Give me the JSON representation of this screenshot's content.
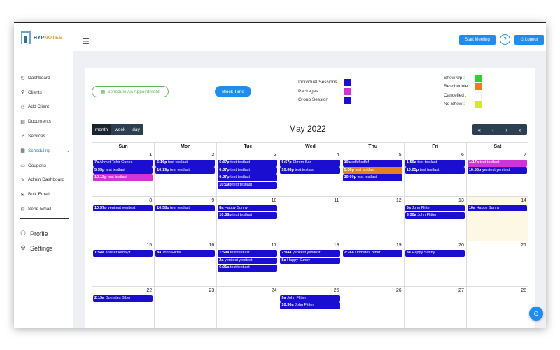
{
  "app": {
    "logo_hyp": "HYP",
    "logo_notes": "NOTES",
    "menu_icon": "hamburger-icon"
  },
  "header": {
    "start_meeting": "Start Meeting",
    "help": "?",
    "logout": "Logout"
  },
  "sidebar": {
    "items": [
      {
        "label": "Dashboard",
        "icon": "◷",
        "name": "dashboard"
      },
      {
        "label": "Clients",
        "icon": "⚲",
        "name": "clients"
      },
      {
        "label": "Add Client",
        "icon": "⚇",
        "name": "add-client"
      },
      {
        "label": "Documents",
        "icon": "▤",
        "name": "documents"
      },
      {
        "label": "Services",
        "icon": "⑂",
        "name": "services"
      },
      {
        "label": "Scheduling",
        "icon": "▦",
        "name": "scheduling",
        "active": true
      },
      {
        "label": "Coupons",
        "icon": "▭",
        "name": "coupons"
      },
      {
        "label": "Admin Dashboard",
        "icon": "✎",
        "name": "admin-dashboard"
      },
      {
        "label": "Bulk Email",
        "icon": "✉",
        "name": "bulk-email"
      },
      {
        "label": "Send Email",
        "icon": "✉",
        "name": "send-email"
      }
    ],
    "bottom": [
      {
        "label": "Profile",
        "icon": "⚇",
        "name": "profile"
      },
      {
        "label": "Settings",
        "icon": "⚙",
        "name": "settings"
      }
    ]
  },
  "toolbar": {
    "schedule": "Schedule An Appointment",
    "block": "Block Time"
  },
  "legend": {
    "types": [
      {
        "label": "Individual Sessions :",
        "color": "#1a0fd1"
      },
      {
        "label": "Packages :",
        "color": "#d233d6"
      },
      {
        "label": "Group Session :",
        "color": "#1a0fd1"
      }
    ],
    "status": [
      {
        "label": "Show Up :",
        "color": "#2fd12f"
      },
      {
        "label": "Reschedule :",
        "color": "#e8801f"
      },
      {
        "label": "Cancelled :",
        "color": "#ffffff"
      },
      {
        "label": "No Show :",
        "color": "#d8e635"
      }
    ]
  },
  "calendar": {
    "views": [
      "month",
      "week",
      "day"
    ],
    "active_view": "month",
    "title": "May 2022",
    "nav": [
      "«",
      "‹",
      "›",
      "»"
    ],
    "weekdays": [
      "Sun",
      "Mon",
      "Tue",
      "Wed",
      "Thu",
      "Fri",
      "Sat"
    ],
    "weeks": [
      [
        {
          "day": "1",
          "events": [
            {
              "time": "7a",
              "title": "Ahmet Tahir Gunes",
              "color": "#1a0fd1"
            },
            {
              "time": "5:55p",
              "title": "test testlast",
              "color": "#1a0fd1"
            },
            {
              "time": "10:19p",
              "title": "test testlast",
              "color": "#d233d6"
            }
          ]
        },
        {
          "day": "2",
          "events": [
            {
              "time": "6:16p",
              "title": "test testlast",
              "color": "#1a0fd1"
            },
            {
              "time": "10:19p",
              "title": "test testlast",
              "color": "#1a0fd1"
            }
          ]
        },
        {
          "day": "3",
          "events": [
            {
              "time": "6:37p",
              "title": "test testlast",
              "color": "#1a0fd1"
            },
            {
              "time": "6:37p",
              "title": "test testlast",
              "color": "#1a0fd1"
            },
            {
              "time": "6:37p",
              "title": "test testlast",
              "color": "#1a0fd1"
            },
            {
              "time": "10:19p",
              "title": "test testlast",
              "color": "#1a0fd1"
            }
          ]
        },
        {
          "day": "4",
          "events": [
            {
              "time": "6:57p",
              "title": "Ekrem Sar",
              "color": "#1a0fd1"
            },
            {
              "time": "10:08p",
              "title": "test testlast",
              "color": "#1a0fd1"
            }
          ]
        },
        {
          "day": "5",
          "events": [
            {
              "time": "10a",
              "title": "sdfsf sdfsf",
              "color": "#1a0fd1"
            },
            {
              "time": "5:56p",
              "title": "test testlast",
              "color": "#e8801f"
            },
            {
              "time": "10:09p",
              "title": "test testlast",
              "color": "#1a0fd1"
            }
          ]
        },
        {
          "day": "6",
          "events": [
            {
              "time": "1:59a",
              "title": "test testlast",
              "color": "#1a0fd1"
            },
            {
              "time": "10:05p",
              "title": "test testlast",
              "color": "#1a0fd1"
            }
          ]
        },
        {
          "day": "7",
          "events": [
            {
              "time": "1:17a",
              "title": "test testlast",
              "color": "#d233d6"
            },
            {
              "time": "10:55p",
              "title": "yenitest yenitest",
              "color": "#1a0fd1"
            }
          ]
        }
      ],
      [
        {
          "day": "8",
          "events": [
            {
              "time": "10:57p",
              "title": "yenitest yenitest",
              "color": "#1a0fd1"
            }
          ]
        },
        {
          "day": "9",
          "events": [
            {
              "time": "10:58p",
              "title": "test testlast",
              "color": "#1a0fd1"
            }
          ]
        },
        {
          "day": "10",
          "events": [
            {
              "time": "8a",
              "title": "Happy Sunny",
              "color": "#1a0fd1"
            },
            {
              "time": "10:58p",
              "title": "test testlast",
              "color": "#1a0fd1"
            }
          ]
        },
        {
          "day": "11",
          "events": []
        },
        {
          "day": "12",
          "events": []
        },
        {
          "day": "13",
          "events": [
            {
              "time": "6a",
              "title": "John Flitter",
              "color": "#1a0fd1"
            },
            {
              "time": "6:30a",
              "title": "John Flitter",
              "color": "#1a0fd1"
            }
          ]
        },
        {
          "day": "14",
          "today": true,
          "events": [
            {
              "time": "10a",
              "title": "Happy Sunny",
              "color": "#1a0fd1"
            }
          ]
        }
      ],
      [
        {
          "day": "15",
          "events": [
            {
              "time": "1:54a",
              "title": "abuzer kadayif",
              "color": "#1a0fd1"
            }
          ]
        },
        {
          "day": "16",
          "events": [
            {
              "time": "8a",
              "title": "John Flitter",
              "color": "#1a0fd1"
            }
          ]
        },
        {
          "day": "17",
          "events": [
            {
              "time": "1:59a",
              "title": "test testlast",
              "color": "#1a0fd1"
            },
            {
              "time": "2a",
              "title": "yenitest yenitest",
              "color": "#1a0fd1"
            },
            {
              "time": "6:01a",
              "title": "test testlast",
              "color": "#1a0fd1"
            }
          ]
        },
        {
          "day": "18",
          "events": [
            {
              "time": "2:04a",
              "title": "yenitest yenitest",
              "color": "#1a0fd1"
            },
            {
              "time": "8a",
              "title": "Happy Sunny",
              "color": "#1a0fd1"
            }
          ]
        },
        {
          "day": "19",
          "events": [
            {
              "time": "2:24a",
              "title": "Domates Biber",
              "color": "#1a0fd1"
            }
          ]
        },
        {
          "day": "20",
          "events": [
            {
              "time": "8a",
              "title": "Happy Sunny",
              "color": "#1a0fd1"
            }
          ]
        },
        {
          "day": "21",
          "events": []
        }
      ],
      [
        {
          "day": "22",
          "events": [
            {
              "time": "2:19a",
              "title": "Domates Biber",
              "color": "#1a0fd1"
            }
          ]
        },
        {
          "day": "23",
          "events": []
        },
        {
          "day": "24",
          "events": []
        },
        {
          "day": "25",
          "events": [
            {
              "time": "9a",
              "title": "John Flitter",
              "color": "#1a0fd1"
            },
            {
              "time": "10:30a",
              "title": "John Flitter",
              "color": "#1a0fd1"
            }
          ]
        },
        {
          "day": "26",
          "events": []
        },
        {
          "day": "27",
          "events": []
        },
        {
          "day": "28",
          "events": []
        }
      ]
    ]
  },
  "fab": {
    "icon": "⊙"
  }
}
